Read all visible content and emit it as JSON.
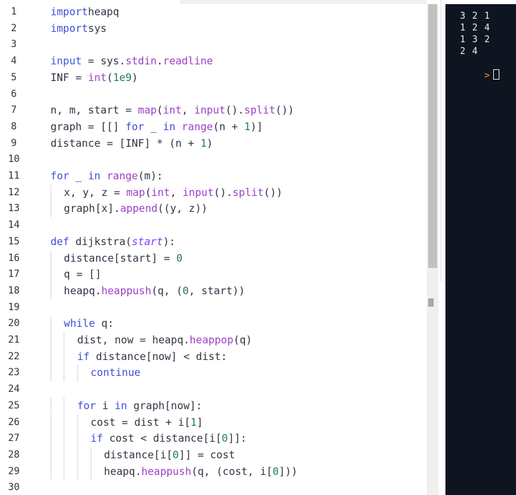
{
  "editor": {
    "lines": [
      {
        "n": "1",
        "i": 0,
        "t": [
          [
            "kw2",
            "import"
          ],
          [
            "",
            "heapq"
          ]
        ]
      },
      {
        "n": "2",
        "i": 0,
        "t": [
          [
            "kw2",
            "import"
          ],
          [
            "",
            "sys"
          ]
        ]
      },
      {
        "n": "3",
        "i": 0,
        "t": []
      },
      {
        "n": "4",
        "i": 0,
        "t": [
          [
            "kb",
            "input"
          ],
          [
            "",
            " = sys."
          ],
          [
            "fn",
            "stdin"
          ],
          [
            "",
            "."
          ],
          [
            "fn",
            "readline"
          ]
        ]
      },
      {
        "n": "5",
        "i": 0,
        "t": [
          [
            "",
            "INF = "
          ],
          [
            "fn",
            "int"
          ],
          [
            "",
            "("
          ],
          [
            "num",
            "1e9"
          ],
          [
            "",
            ")"
          ]
        ]
      },
      {
        "n": "6",
        "i": 0,
        "t": []
      },
      {
        "n": "7",
        "i": 0,
        "t": [
          [
            "",
            "n, m, start = "
          ],
          [
            "fn",
            "map"
          ],
          [
            "",
            "("
          ],
          [
            "fn",
            "int"
          ],
          [
            "",
            ", "
          ],
          [
            "fn",
            "input"
          ],
          [
            "",
            "()."
          ],
          [
            "fn",
            "split"
          ],
          [
            "",
            "())"
          ]
        ]
      },
      {
        "n": "8",
        "i": 0,
        "t": [
          [
            "",
            "graph = [[] "
          ],
          [
            "kw2",
            "for"
          ],
          [
            "",
            " _ "
          ],
          [
            "kw2",
            "in"
          ],
          [
            "",
            " "
          ],
          [
            "fn",
            "range"
          ],
          [
            "",
            "(n + "
          ],
          [
            "num",
            "1"
          ],
          [
            "",
            ")]"
          ]
        ]
      },
      {
        "n": "9",
        "i": 0,
        "t": [
          [
            "",
            "distance = [INF] * (n + "
          ],
          [
            "num",
            "1"
          ],
          [
            "",
            ")"
          ]
        ]
      },
      {
        "n": "10",
        "i": 0,
        "t": []
      },
      {
        "n": "11",
        "i": 0,
        "t": [
          [
            "kw2",
            "for"
          ],
          [
            "",
            " _ "
          ],
          [
            "kw2",
            "in"
          ],
          [
            "",
            " "
          ],
          [
            "fn",
            "range"
          ],
          [
            "",
            "(m):"
          ]
        ]
      },
      {
        "n": "12",
        "i": 1,
        "t": [
          [
            "",
            "x, y, z = "
          ],
          [
            "fn",
            "map"
          ],
          [
            "",
            "("
          ],
          [
            "fn",
            "int"
          ],
          [
            "",
            ", "
          ],
          [
            "fn",
            "input"
          ],
          [
            "",
            "()."
          ],
          [
            "fn",
            "split"
          ],
          [
            "",
            "())"
          ]
        ]
      },
      {
        "n": "13",
        "i": 1,
        "t": [
          [
            "",
            "graph[x]."
          ],
          [
            "fn",
            "append"
          ],
          [
            "",
            "((y, z))"
          ]
        ]
      },
      {
        "n": "14",
        "i": 0,
        "t": []
      },
      {
        "n": "15",
        "i": 0,
        "t": [
          [
            "kw2",
            "def"
          ],
          [
            "",
            " dijkstra("
          ],
          [
            "it",
            "start"
          ],
          [
            "",
            "):"
          ]
        ]
      },
      {
        "n": "16",
        "i": 1,
        "t": [
          [
            "",
            "distance[start] = "
          ],
          [
            "num",
            "0"
          ]
        ]
      },
      {
        "n": "17",
        "i": 1,
        "t": [
          [
            "",
            "q = []"
          ]
        ]
      },
      {
        "n": "18",
        "i": 1,
        "t": [
          [
            "",
            "heapq."
          ],
          [
            "fn",
            "heappush"
          ],
          [
            "",
            "(q, ("
          ],
          [
            "num",
            "0"
          ],
          [
            "",
            ", start))"
          ]
        ]
      },
      {
        "n": "19",
        "i": 0,
        "t": []
      },
      {
        "n": "20",
        "i": 1,
        "t": [
          [
            "kw2",
            "while"
          ],
          [
            "",
            " q:"
          ]
        ]
      },
      {
        "n": "21",
        "i": 2,
        "t": [
          [
            "",
            "dist, now = heapq."
          ],
          [
            "fn",
            "heappop"
          ],
          [
            "",
            "(q)"
          ]
        ]
      },
      {
        "n": "22",
        "i": 2,
        "t": [
          [
            "kw2",
            "if"
          ],
          [
            "",
            " distance[now] < dist:"
          ]
        ]
      },
      {
        "n": "23",
        "i": 3,
        "t": [
          [
            "kw2",
            "continue"
          ]
        ]
      },
      {
        "n": "24",
        "i": 0,
        "t": []
      },
      {
        "n": "25",
        "i": 2,
        "t": [
          [
            "kw2",
            "for"
          ],
          [
            "",
            " i "
          ],
          [
            "kw2",
            "in"
          ],
          [
            "",
            " graph[now]:"
          ]
        ]
      },
      {
        "n": "26",
        "i": 3,
        "t": [
          [
            "",
            "cost = dist + i["
          ],
          [
            "num",
            "1"
          ],
          [
            "",
            "]"
          ]
        ]
      },
      {
        "n": "27",
        "i": 3,
        "t": [
          [
            "kw2",
            "if"
          ],
          [
            "",
            " cost < distance[i["
          ],
          [
            "num",
            "0"
          ],
          [
            "",
            "]]:"
          ]
        ]
      },
      {
        "n": "28",
        "i": 4,
        "t": [
          [
            "",
            "distance[i["
          ],
          [
            "num",
            "0"
          ],
          [
            "",
            "]] = cost"
          ]
        ]
      },
      {
        "n": "29",
        "i": 4,
        "t": [
          [
            "",
            "heapq."
          ],
          [
            "fn",
            "heappush"
          ],
          [
            "",
            "(q, (cost, i["
          ],
          [
            "num",
            "0"
          ],
          [
            "",
            "]))"
          ]
        ]
      },
      {
        "n": "30",
        "i": 0,
        "t": []
      }
    ]
  },
  "terminal": {
    "lines": [
      "3 2 1",
      "1 2 4",
      "1 3 2",
      "2 4"
    ],
    "prompt": ">"
  }
}
